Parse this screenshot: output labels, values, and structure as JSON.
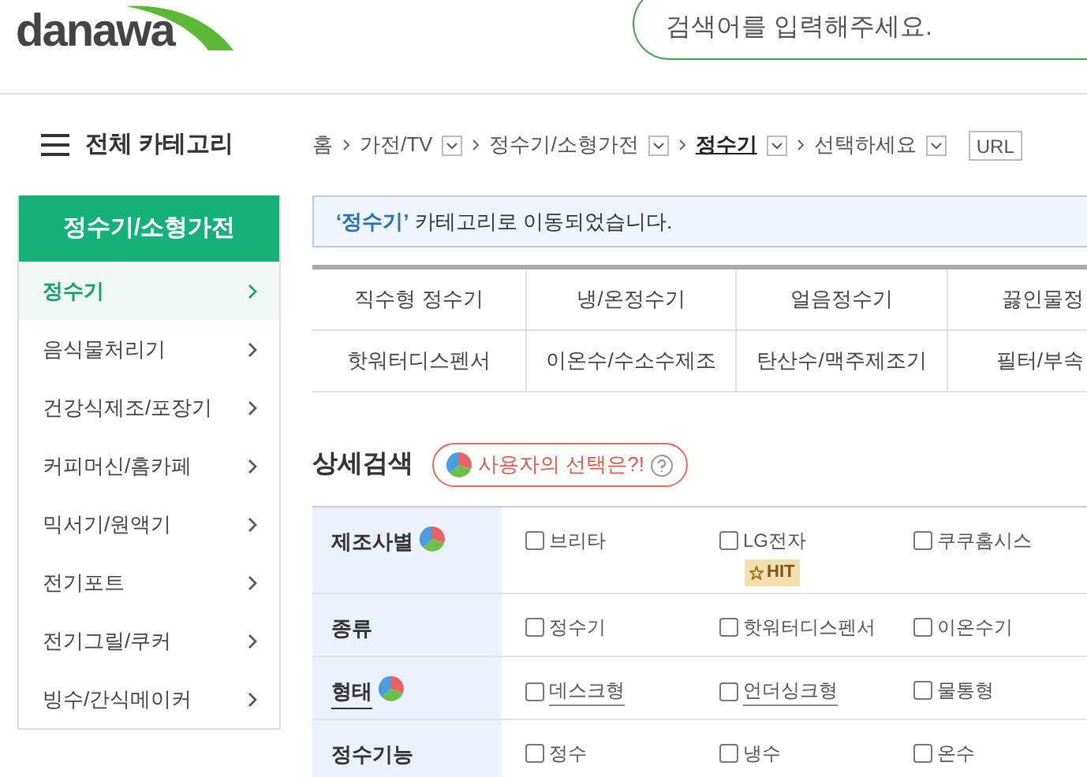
{
  "header": {
    "logo": "danawa",
    "search": {
      "placeholder": "검색어를 입력해주세요."
    }
  },
  "all_categories": "전체 카테고리",
  "sidebar": {
    "title": "정수기/소형가전",
    "items": [
      {
        "label": "정수기",
        "selected": true
      },
      {
        "label": "음식물처리기",
        "selected": false
      },
      {
        "label": "건강식제조/포장기",
        "selected": false
      },
      {
        "label": "커피머신/홈카페",
        "selected": false
      },
      {
        "label": "믹서기/원액기",
        "selected": false
      },
      {
        "label": "전기포트",
        "selected": false
      },
      {
        "label": "전기그릴/쿠커",
        "selected": false
      },
      {
        "label": "빙수/간식메이커",
        "selected": false
      }
    ]
  },
  "breadcrumb": {
    "items": [
      {
        "label": "홈",
        "kind": "link",
        "current": false
      },
      {
        "label": "가전/TV",
        "kind": "dropdown",
        "current": false
      },
      {
        "label": "정수기/소형가전",
        "kind": "dropdown",
        "current": false
      },
      {
        "label": "정수기",
        "kind": "dropdown",
        "current": true
      },
      {
        "label": "선택하세요",
        "kind": "dropdown",
        "current": false
      }
    ],
    "url_button": "URL"
  },
  "notice": "**‘정수기’** 카테고리로 이동되었습니다.",
  "subcategories": [
    [
      "직수형 정수기",
      "냉/온정수기",
      "얼음정수기",
      "끓인물정"
    ],
    [
      "핫워터디스펜서",
      "이온수/수소수제조",
      "탄산수/맥주제조기",
      "필터/부속"
    ]
  ],
  "detail_search": {
    "title": "상세검색",
    "user_choice": "사용자의 선택은?!",
    "filters": [
      {
        "label": "제조사별",
        "chart_icon": true,
        "linked": false,
        "options": [
          {
            "label": "브리타",
            "checked": false,
            "linked": false
          },
          {
            "label": "LG전자",
            "checked": false,
            "linked": false,
            "badge": "HIT"
          },
          {
            "label": "쿠쿠홈시스",
            "checked": false,
            "linked": false
          }
        ]
      },
      {
        "label": "종류",
        "chart_icon": false,
        "linked": false,
        "options": [
          {
            "label": "정수기",
            "checked": false,
            "linked": false
          },
          {
            "label": "핫워터디스펜서",
            "checked": false,
            "linked": false
          },
          {
            "label": "이온수기",
            "checked": false,
            "linked": false
          }
        ]
      },
      {
        "label": "형태",
        "chart_icon": true,
        "linked": true,
        "options": [
          {
            "label": "데스크형",
            "checked": false,
            "linked": true
          },
          {
            "label": "언더싱크형",
            "checked": false,
            "linked": true
          },
          {
            "label": "물통형",
            "checked": false,
            "linked": false
          }
        ]
      },
      {
        "label": "정수기능",
        "chart_icon": false,
        "linked": false,
        "options": [
          {
            "label": "정수",
            "checked": false,
            "linked": false
          },
          {
            "label": "냉수",
            "checked": false,
            "linked": false
          },
          {
            "label": "온수",
            "checked": false,
            "linked": false
          }
        ]
      }
    ]
  }
}
